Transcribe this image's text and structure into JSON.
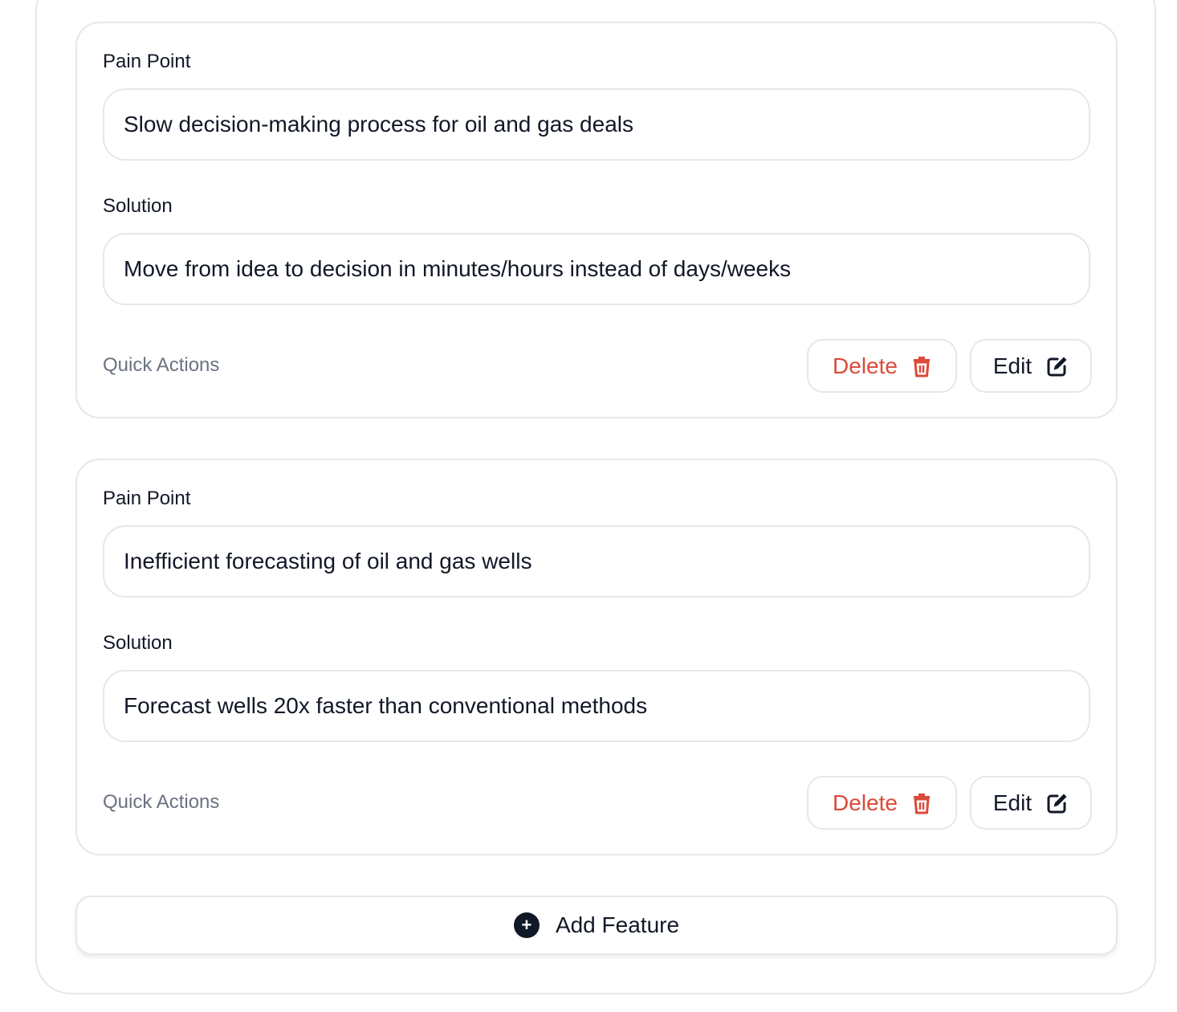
{
  "features": [
    {
      "pain_point_label": "Pain Point",
      "pain_point_value": "Slow decision-making process for oil and gas deals",
      "solution_label": "Solution",
      "solution_value": "Move from idea to decision in minutes/hours instead of days/weeks",
      "quick_actions_label": "Quick Actions",
      "delete_label": "Delete",
      "edit_label": "Edit"
    },
    {
      "pain_point_label": "Pain Point",
      "pain_point_value": "Inefficient forecasting of oil and gas wells",
      "solution_label": "Solution",
      "solution_value": "Forecast wells 20x faster than conventional methods",
      "quick_actions_label": "Quick Actions",
      "delete_label": "Delete",
      "edit_label": "Edit"
    }
  ],
  "add_feature_label": "Add Feature",
  "icons": {
    "delete": "trash-icon",
    "edit": "edit-icon",
    "add": "plus-circle-icon"
  },
  "colors": {
    "danger": "#dc4a3a",
    "text": "#111827",
    "muted": "#6b7280",
    "border": "#e5e7eb"
  }
}
